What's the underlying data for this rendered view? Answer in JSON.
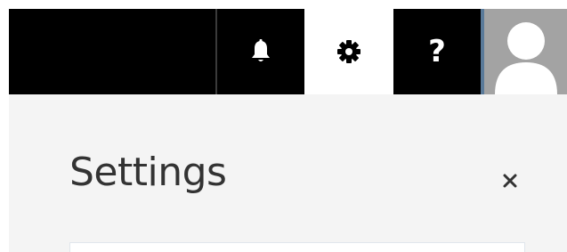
{
  "topbar": {
    "buttons": [
      {
        "icon": "bell-icon"
      },
      {
        "icon": "gear-icon",
        "selected": true
      },
      {
        "icon": "help-icon",
        "glyph": "?"
      }
    ],
    "avatar_icon": "user-avatar-icon"
  },
  "settings_panel": {
    "title": "Settings",
    "close_icon": "close-icon",
    "close_glyph": "×"
  },
  "colors": {
    "topbar_bg": "#000000",
    "selected_tab_bg": "#ffffff",
    "panel_bg": "#f4f4f4",
    "avatar_bg": "#a3a3a3",
    "title_text": "#333333"
  }
}
